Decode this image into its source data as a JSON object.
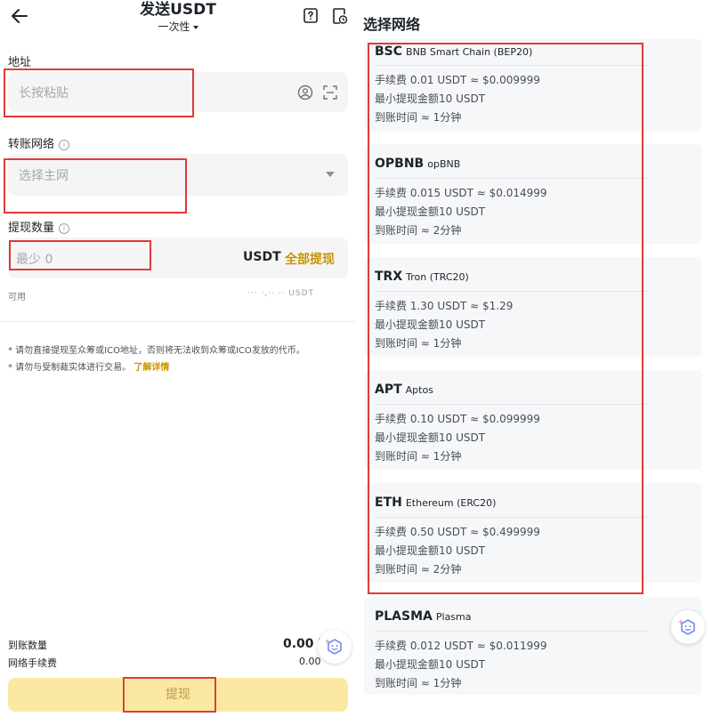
{
  "left": {
    "header": {
      "title": "发送USDT",
      "mode": "一次性"
    },
    "address": {
      "label": "地址",
      "placeholder": "长按粘贴"
    },
    "network": {
      "label": "转账网络",
      "placeholder": "选择主网"
    },
    "amount": {
      "label": "提现数量",
      "placeholder": "最少 0",
      "unit": "USDT",
      "max_label": "全部提现"
    },
    "available": {
      "label": "可用",
      "value": "··· ·,·· ·· USDT"
    },
    "notices": [
      "* 请勿直接提现至众筹或ICO地址，否则将无法收到众筹或ICO发放的代币。",
      "* 请勿与受制裁实体进行交易。"
    ],
    "learn_more": "了解详情",
    "summary": {
      "receive_label": "到账数量",
      "receive_value": "0.00 U",
      "fee_label": "网络手续费",
      "fee_value": "0.00"
    },
    "submit_label": "提现"
  },
  "right": {
    "title": "选择网络",
    "networks": [
      {
        "code": "BSC",
        "name": "BNB Smart Chain (BEP20)",
        "fee": "手续费 0.01 USDT ≈ $0.009999",
        "min": "最小提现金额10 USDT",
        "time": "到账时间 ≈ 1分钟"
      },
      {
        "code": "OPBNB",
        "name": "opBNB",
        "fee": "手续费 0.015 USDT ≈ $0.014999",
        "min": "最小提现金额10 USDT",
        "time": "到账时间 ≈ 2分钟"
      },
      {
        "code": "TRX",
        "name": "Tron (TRC20)",
        "fee": "手续费 1.30 USDT ≈ $1.29",
        "min": "最小提现金额10 USDT",
        "time": "到账时间 ≈ 1分钟"
      },
      {
        "code": "APT",
        "name": "Aptos",
        "fee": "手续费 0.10 USDT ≈ $0.099999",
        "min": "最小提现金额10 USDT",
        "time": "到账时间 ≈ 1分钟"
      },
      {
        "code": "ETH",
        "name": "Ethereum (ERC20)",
        "fee": "手续费 0.50 USDT ≈ $0.499999",
        "min": "最小提现金额10 USDT",
        "time": "到账时间 ≈ 2分钟"
      },
      {
        "code": "PLASMA",
        "name": "Plasma",
        "fee": "手续费 0.012 USDT ≈ $0.011999",
        "min": "最小提现金额10 USDT",
        "time": "到账时间 ≈ 1分钟"
      }
    ]
  },
  "colors": {
    "accent": "#c99400",
    "highlight_box": "#e03a3a",
    "submit_bg": "#fbe9a3"
  },
  "icons": [
    "back-arrow-icon",
    "help-icon",
    "history-icon",
    "contact-icon",
    "scan-icon",
    "info-icon",
    "chevron-down-icon",
    "ai-assistant-icon"
  ]
}
